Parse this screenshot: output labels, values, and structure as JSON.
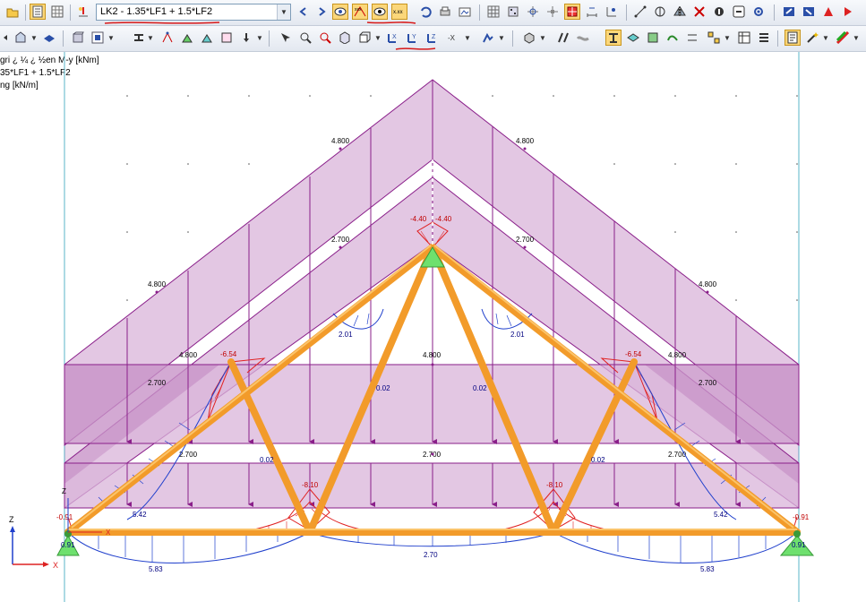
{
  "toolbar": {
    "load_combo": "LK2 - 1.35*LF1 + 1.5*LF2"
  },
  "info_panel": {
    "line1": "gri ¿ ¼ ¿ ½en M-y [kNm]",
    "line2": "35*LF1 + 1.5*LF2",
    "line3": "ng [kN/m]"
  },
  "axes": {
    "z": "Z",
    "x": "X"
  },
  "loads": {
    "outer_left": "4.800",
    "outer_right": "4.800",
    "inner_left": "2.700",
    "inner_right": "2.700",
    "mid_left": "4.800",
    "mid_right": "4.800",
    "low_left": "4.800",
    "low_right": "4.800",
    "second_left": "2.700",
    "second_right": "2.700",
    "rect_top": "4.800",
    "rect_bottom": "2.700",
    "lower_left": "2.700",
    "lower_right": "2.700"
  },
  "moments": {
    "apex_left": "-4.40",
    "apex_right": "-4.40",
    "top_left": "-6.54",
    "top_right": "-6.54",
    "mid_left": "-8.10",
    "mid_right": "-8.10",
    "support_left": "-0.91",
    "support_right": "-0.91",
    "chord_left": "2.01",
    "chord_right": "2.01",
    "diag_left": "0.02",
    "diag_right": "0.02",
    "bottom_web_left": "0.02",
    "bottom_web_right": "0.02",
    "rafter_left": "5.42",
    "rafter_right": "5.42",
    "bottom_left": "5.83",
    "bottom_center": "2.70",
    "bottom_right": "5.83",
    "reaction_left": "0.91",
    "reaction_right": "0.91"
  },
  "colors": {
    "load_fill": "#d9b4d9",
    "load_line": "#8a1f8a",
    "member": "#f29b2a",
    "moment_pos": "#1f3fcc",
    "moment_neg": "#e02020",
    "support": "#6ee06e",
    "grid_line": "#5ab4c8"
  }
}
